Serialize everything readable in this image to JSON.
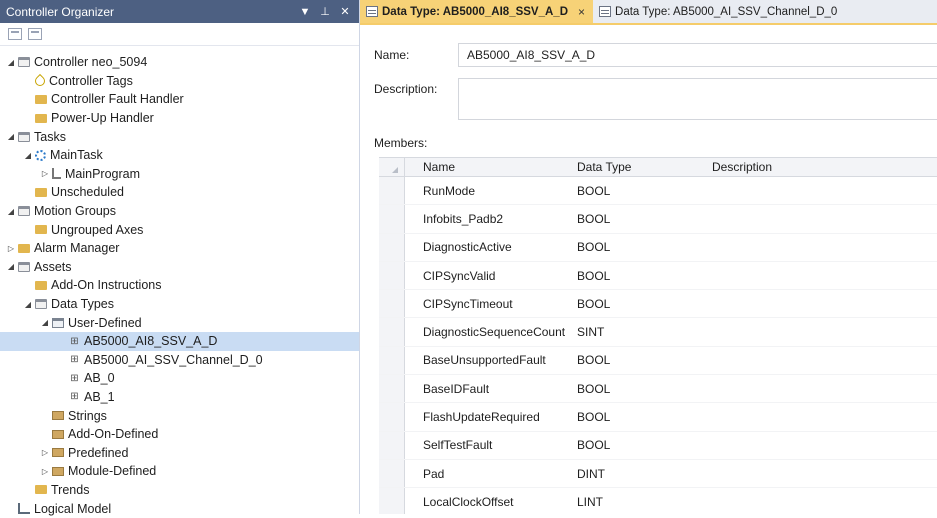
{
  "organizer": {
    "title": "Controller Organizer",
    "tree": [
      {
        "label": "Controller neo_5094",
        "indent": 0,
        "exp": "◢",
        "icon": "folder-open",
        "icon_name": "folder-open-icon"
      },
      {
        "label": "Controller Tags",
        "indent": 1,
        "exp": "",
        "icon": "tag",
        "icon_name": "tag-icon"
      },
      {
        "label": "Controller Fault Handler",
        "indent": 1,
        "exp": "",
        "icon": "folder",
        "icon_name": "folder-icon"
      },
      {
        "label": "Power-Up Handler",
        "indent": 1,
        "exp": "",
        "icon": "folder",
        "icon_name": "folder-icon"
      },
      {
        "label": "Tasks",
        "indent": 0,
        "exp": "◢",
        "icon": "folder-open",
        "icon_name": "folder-open-icon"
      },
      {
        "label": "MainTask",
        "indent": 1,
        "exp": "◢",
        "icon": "task",
        "icon_name": "task-icon"
      },
      {
        "label": "MainProgram",
        "indent": 2,
        "exp": "▷",
        "icon": "program",
        "icon_name": "program-icon"
      },
      {
        "label": "Unscheduled",
        "indent": 1,
        "exp": "",
        "icon": "folder",
        "icon_name": "folder-icon"
      },
      {
        "label": "Motion Groups",
        "indent": 0,
        "exp": "◢",
        "icon": "folder-open",
        "icon_name": "folder-open-icon"
      },
      {
        "label": "Ungrouped Axes",
        "indent": 1,
        "exp": "",
        "icon": "folder",
        "icon_name": "folder-icon"
      },
      {
        "label": "Alarm Manager",
        "indent": 0,
        "exp": "▷",
        "icon": "folder",
        "icon_name": "folder-icon"
      },
      {
        "label": "Assets",
        "indent": 0,
        "exp": "◢",
        "icon": "folder-open",
        "icon_name": "folder-open-icon"
      },
      {
        "label": "Add-On Instructions",
        "indent": 1,
        "exp": "",
        "icon": "folder",
        "icon_name": "folder-icon"
      },
      {
        "label": "Data Types",
        "indent": 1,
        "exp": "◢",
        "icon": "folder-open",
        "icon_name": "folder-open-icon"
      },
      {
        "label": "User-Defined",
        "indent": 2,
        "exp": "◢",
        "icon": "dtfolder",
        "icon_name": "datatype-folder-icon"
      },
      {
        "label": "AB5000_AI8_SSV_A_D",
        "indent": 3,
        "exp": "",
        "icon": "dtype",
        "icon_name": "datatype-icon",
        "selected": true
      },
      {
        "label": "AB5000_AI_SSV_Channel_D_0",
        "indent": 3,
        "exp": "",
        "icon": "dtype",
        "icon_name": "datatype-icon"
      },
      {
        "label": "AB_0",
        "indent": 3,
        "exp": "",
        "icon": "dtype",
        "icon_name": "datatype-icon"
      },
      {
        "label": "AB_1",
        "indent": 3,
        "exp": "",
        "icon": "dtype",
        "icon_name": "datatype-icon"
      },
      {
        "label": "Strings",
        "indent": 2,
        "exp": "",
        "icon": "dtfold2",
        "icon_name": "strings-folder-icon"
      },
      {
        "label": "Add-On-Defined",
        "indent": 2,
        "exp": "",
        "icon": "dtfold2",
        "icon_name": "aoi-folder-icon"
      },
      {
        "label": "Predefined",
        "indent": 2,
        "exp": "▷",
        "icon": "dtfold2",
        "icon_name": "predefined-folder-icon"
      },
      {
        "label": "Module-Defined",
        "indent": 2,
        "exp": "▷",
        "icon": "dtfold2",
        "icon_name": "module-folder-icon"
      },
      {
        "label": "Trends",
        "indent": 1,
        "exp": "",
        "icon": "folder",
        "icon_name": "folder-icon"
      },
      {
        "label": "Logical Model",
        "indent": 0,
        "exp": "",
        "icon": "logical",
        "icon_name": "logical-model-icon"
      }
    ]
  },
  "tabs": [
    {
      "label": "Data Type:  AB5000_AI8_SSV_A_D",
      "active": true,
      "close": "×"
    },
    {
      "label": "Data Type:  AB5000_AI_SSV_Channel_D_0",
      "active": false,
      "close": ""
    }
  ],
  "form": {
    "name_label": "Name:",
    "name_value": "AB5000_AI8_SSV_A_D",
    "description_label": "Description:",
    "description_value": "",
    "members_label": "Members:"
  },
  "grid": {
    "headers": {
      "name": "Name",
      "type": "Data Type",
      "description": "Description"
    },
    "rows": [
      {
        "name": "RunMode",
        "type": "BOOL"
      },
      {
        "name": "Infobits_Padb2",
        "type": "BOOL"
      },
      {
        "name": "DiagnosticActive",
        "type": "BOOL"
      },
      {
        "name": "CIPSyncValid",
        "type": "BOOL"
      },
      {
        "name": "CIPSyncTimeout",
        "type": "BOOL"
      },
      {
        "name": "DiagnosticSequenceCount",
        "type": "SINT"
      },
      {
        "name": "BaseUnsupportedFault",
        "type": "BOOL"
      },
      {
        "name": "BaseIDFault",
        "type": "BOOL"
      },
      {
        "name": "FlashUpdateRequired",
        "type": "BOOL"
      },
      {
        "name": "SelfTestFault",
        "type": "BOOL"
      },
      {
        "name": "Pad",
        "type": "DINT"
      },
      {
        "name": "LocalClockOffset",
        "type": "LINT"
      }
    ]
  },
  "colors": {
    "titlebar": "#4d6082",
    "active_tab": "#f7d277",
    "selection": "#c9dcf3"
  }
}
